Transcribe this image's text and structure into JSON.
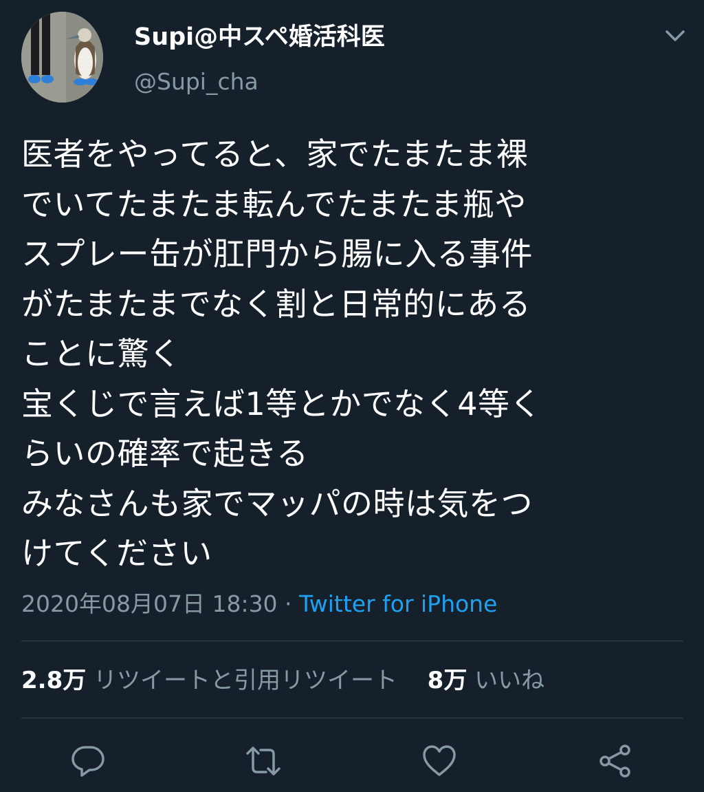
{
  "tweet": {
    "display_name": "Supi@中スペ婚活科医",
    "handle": "@Supi_cha",
    "text": "医者をやってると、家でたまたま裸\nでいてたまたま転んでたまたま瓶や\nスプレー缶が肛門から腸に入る事件\nがたまたまでなく割と日常的にある\nことに驚く\n宝くじで言えば1等とかでなく4等く\nらいの確率で起きる\nみなさんも家でマッパの時は気をつ\nけてください",
    "timestamp": "2020年08月07日 18:30",
    "separator": " · ",
    "source": "Twitter for iPhone"
  },
  "stats": {
    "retweets_count": "2.8万",
    "retweets_label": "リツイートと引用リツイート",
    "likes_count": "8万",
    "likes_label": "いいね"
  },
  "icons": {
    "menu": "chevron-down-icon",
    "reply": "reply-icon",
    "retweet": "retweet-icon",
    "like": "heart-icon",
    "share": "share-icon"
  },
  "colors": {
    "background": "#15202b",
    "text_primary": "#ffffff",
    "text_secondary": "#8899a6",
    "link": "#1da1f2",
    "divider": "#38444d"
  }
}
